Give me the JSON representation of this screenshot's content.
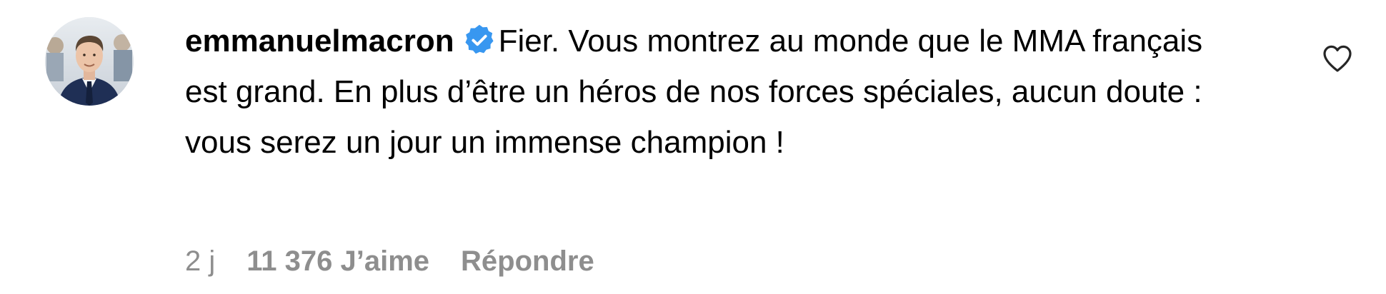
{
  "comment": {
    "username": "emmanuelmacron",
    "verified_icon": "verified-badge-icon",
    "text": "Fier. Vous montrez au monde que le MMA français est grand. En plus d’être un héros de nos forces spéciales, aucun doute : vous serez un jour un immense champion !",
    "time": "2 j",
    "likes": "11 376 J’aime",
    "reply_label": "Répondre",
    "like_icon": "heart-outline-icon"
  },
  "colors": {
    "verified_blue": "#3897f0",
    "meta_gray": "#8e8e8e",
    "text": "#000000"
  }
}
